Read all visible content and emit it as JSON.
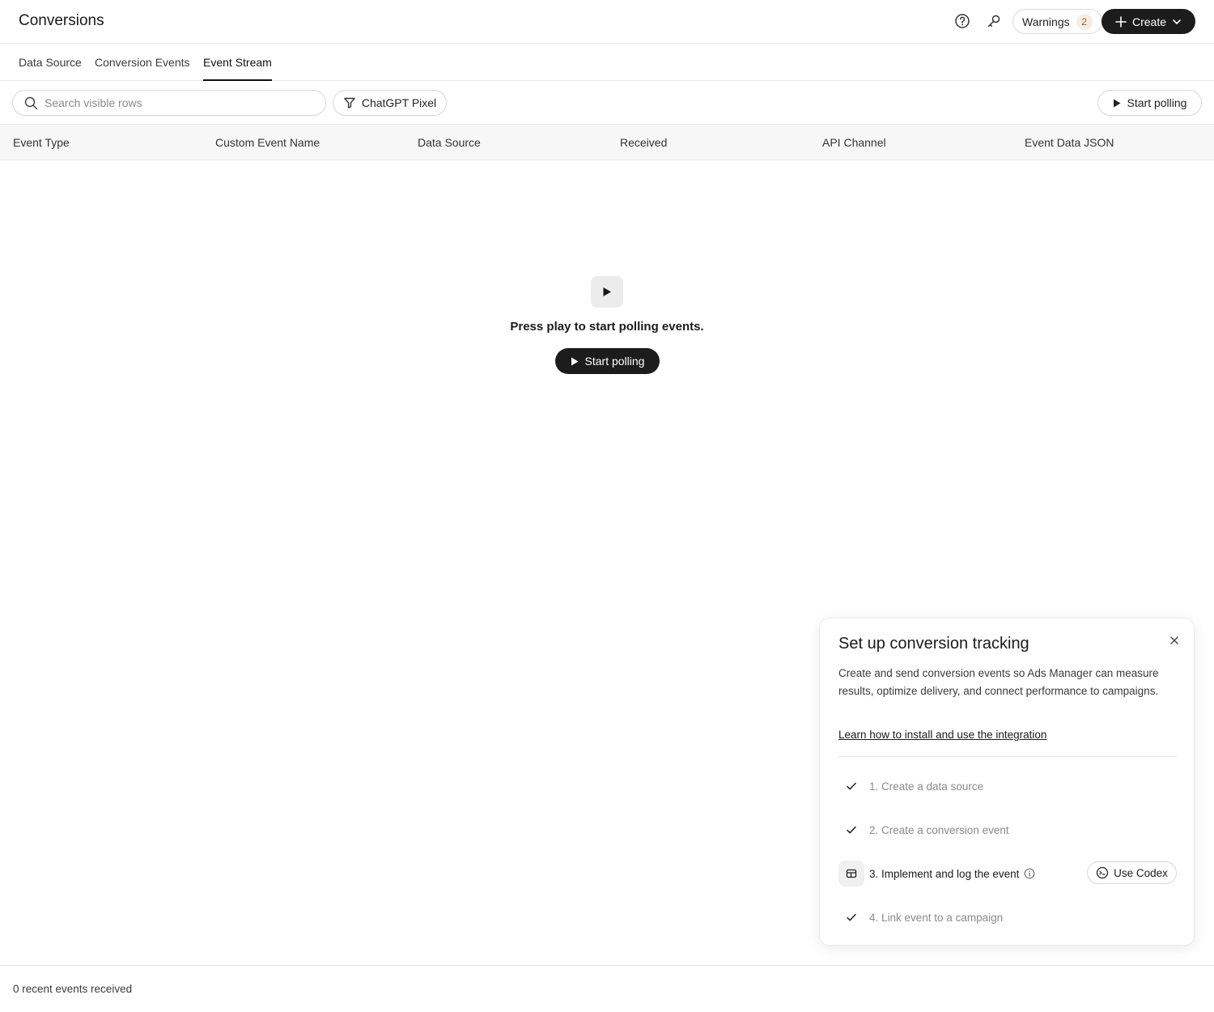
{
  "header": {
    "title": "Conversions",
    "warnings_label": "Warnings",
    "warnings_count": "2",
    "create_label": "Create"
  },
  "tabs": [
    {
      "label": "Data Source",
      "active": false
    },
    {
      "label": "Conversion Events",
      "active": false
    },
    {
      "label": "Event Stream",
      "active": true
    }
  ],
  "toolbar": {
    "search_placeholder": "Search visible rows",
    "filter_label": "ChatGPT Pixel",
    "start_polling_label": "Start polling"
  },
  "table": {
    "columns": [
      "Event Type",
      "Custom Event Name",
      "Data Source",
      "Received",
      "API Channel",
      "Event Data JSON"
    ],
    "rows": []
  },
  "empty_state": {
    "message": "Press play to start polling events.",
    "button_label": "Start polling"
  },
  "setup_panel": {
    "title": "Set up conversion tracking",
    "description": "Create and send conversion events so Ads Manager can measure results, optimize delivery, and connect performance to campaigns.",
    "link_label": "Learn how to install and use the integration",
    "steps": [
      {
        "label": "1. Create a data source",
        "status": "done"
      },
      {
        "label": "2. Create a conversion event",
        "status": "done"
      },
      {
        "label": "3. Implement and log the event",
        "status": "current",
        "action_label": "Use Codex"
      },
      {
        "label": "4. Link event to a campaign",
        "status": "done"
      }
    ]
  },
  "footer": {
    "status": "0 recent events received"
  },
  "colors": {
    "primary_button": "#1c1c1c",
    "warning_badge_bg": "#f6eee6",
    "warning_badge_text": "#b55b1e",
    "table_header_bg": "#f7f7f7"
  }
}
